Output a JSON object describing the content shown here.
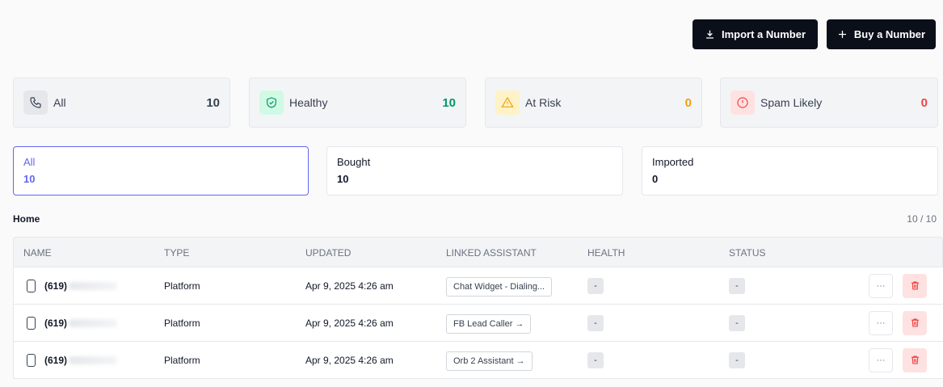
{
  "header": {
    "import_label": "Import a Number",
    "buy_label": "Buy a Number"
  },
  "stats": [
    {
      "label": "All",
      "count": "10",
      "icon": "phone-icon",
      "color": "#374151",
      "bg": "#e5e7eb"
    },
    {
      "label": "Healthy",
      "count": "10",
      "icon": "shield-check-icon",
      "color": "#059669",
      "bg": "#d1fae5"
    },
    {
      "label": "At Risk",
      "count": "0",
      "icon": "warning-icon",
      "color": "#f59e0b",
      "bg": "#fef3c7"
    },
    {
      "label": "Spam Likely",
      "count": "0",
      "icon": "alert-circle-icon",
      "color": "#ef4444",
      "bg": "#fee2e2"
    }
  ],
  "tabs": [
    {
      "label": "All",
      "count": "10"
    },
    {
      "label": "Bought",
      "count": "10"
    },
    {
      "label": "Imported",
      "count": "0"
    }
  ],
  "section": {
    "title": "Home",
    "count": "10 / 10"
  },
  "table": {
    "columns": [
      "NAME",
      "TYPE",
      "UPDATED",
      "LINKED ASSISTANT",
      "HEALTH",
      "STATUS"
    ],
    "rows": [
      {
        "number": "(619)",
        "number_suffix": "",
        "type": "Platform",
        "updated": "Apr 9, 2025 4:26 am",
        "assistant": "Chat Widget - Dialing...",
        "health": "-",
        "status": "-"
      },
      {
        "number": "(619)",
        "number_suffix": "",
        "type": "Platform",
        "updated": "Apr 9, 2025 4:26 am",
        "assistant": "FB Lead Caller →",
        "health": "-",
        "status": "-"
      },
      {
        "number": "(619)",
        "number_suffix": "",
        "type": "Platform",
        "updated": "Apr 9, 2025 4:26 am",
        "assistant": "Orb 2 Assistant →",
        "health": "-",
        "status": "-"
      }
    ],
    "more_label": "···"
  }
}
